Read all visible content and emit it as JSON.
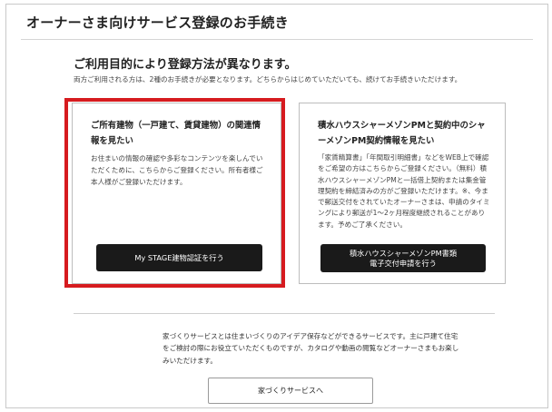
{
  "header": {
    "title": "オーナーさま向けサービス登録のお手続き"
  },
  "intro": {
    "heading": "ご利用目的により登録方法が異なります。",
    "description": "両方ご利用される方は、2種のお手続きが必要となります。どちらからはじめていただいても、続けてお手続きいただけます。"
  },
  "cards": [
    {
      "title": "ご所有建物（一戸建て、賃貸建物）の関連情報を見たい",
      "body": "お住まいの情報の確認や多彩なコンテンツを楽しんでいただくために、こちらからご登録ください。所有者様ご本人様がご登録いただけます。",
      "button_line1": "My STAGE建物認証を行う",
      "button_line2": ""
    },
    {
      "title": "積水ハウスシャーメゾンPMと契約中のシャーメゾンPM契約情報を見たい",
      "body": "「家賃精算書」「年間取引明細書」などをWEB上で確認をご希望の方はこちらからご登録ください。（無料）積水ハウスシャーメゾンPMと一括借上契約または集金管理契約を締結済みの方がご登録いただけます。※、今まで郵送交付をされていたオーナーさまは、申請のタイミングにより郵送が1〜2ヶ月程度継続されることがあります。予めご了承ください。",
      "button_line1": "積水ハウスシャーメゾンPM書類",
      "button_line2": "電子交付申請を行う"
    }
  ],
  "footer": {
    "description": "家づくりサービスとは住まいづくりのアイデア保存などができるサービスです。主に戸建て住宅をご検討の際にお役立ていただくものですが、カタログや動画の閲覧などオーナーさまもお楽しみいただけます。",
    "button_label": "家づくりサービスへ"
  },
  "colors": {
    "highlight": "#d61b1f",
    "button_dark": "#1a1a1a"
  }
}
